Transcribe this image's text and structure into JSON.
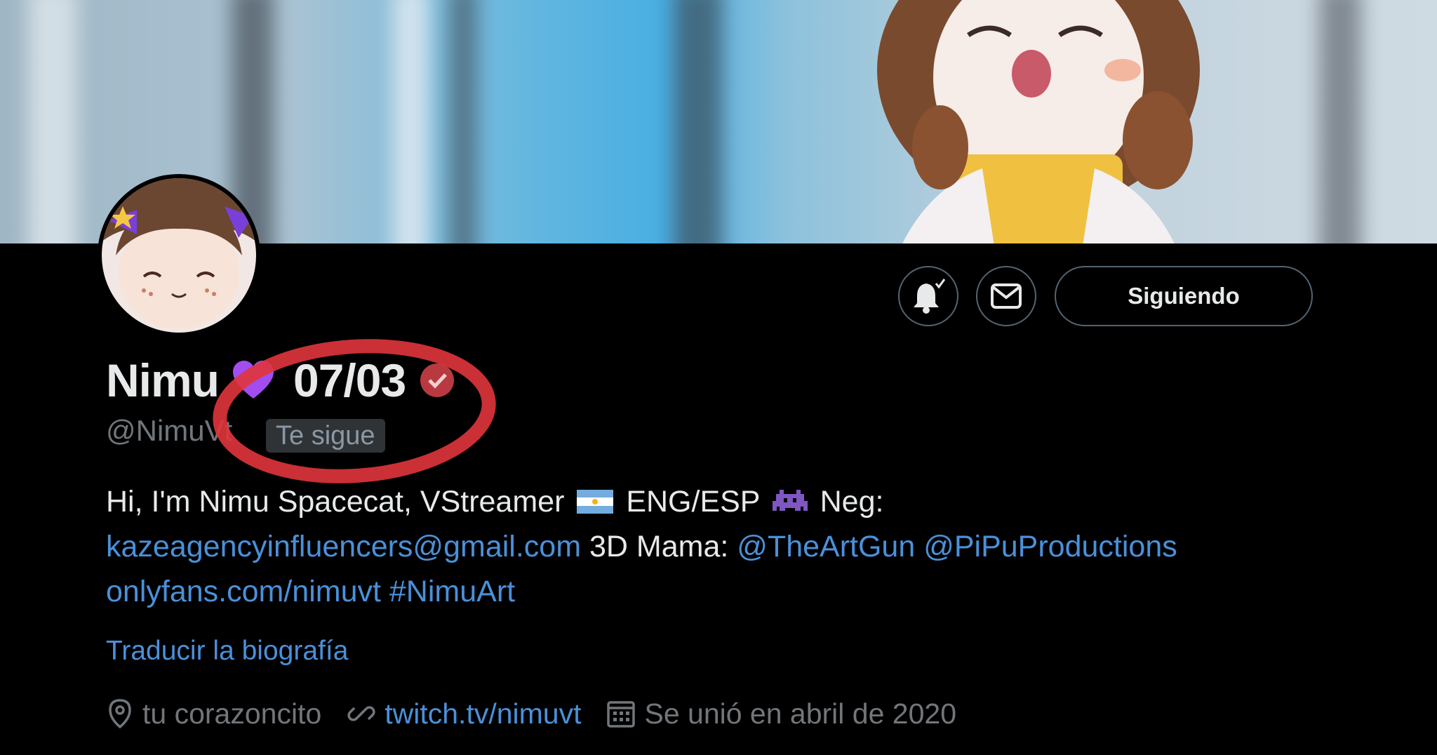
{
  "profile": {
    "display_name": "Nimu",
    "name_suffix": "07/03",
    "handle": "@NimuVt",
    "follows_you_badge": "Te sigue"
  },
  "actions": {
    "notifications_icon": "bell-check-icon",
    "message_icon": "envelope-icon",
    "following_label": "Siguiendo"
  },
  "bio": {
    "text_1": "Hi, I'm Nimu Spacecat, VStreamer",
    "text_2": "ENG/ESP",
    "text_3": "Neg:",
    "email_link": "kazeagencyinfluencers@gmail.com",
    "text_4": "3D Mama:",
    "mention_1": "@TheArtGun",
    "mention_2": "@PiPuProductions",
    "url_link": "onlyfans.com/nimuvt",
    "hashtag": "#NimuArt"
  },
  "translate_label": "Traducir la biografía",
  "meta": {
    "location": "tu corazoncito",
    "website": "twitch.tv/nimuvt",
    "joined": "Se unió en abril de 2020"
  },
  "colors": {
    "background": "#000000",
    "link": "#4a90d9",
    "secondary_text": "#71767b",
    "annotation_red": "#e0353b",
    "heart": "#a24df0"
  }
}
